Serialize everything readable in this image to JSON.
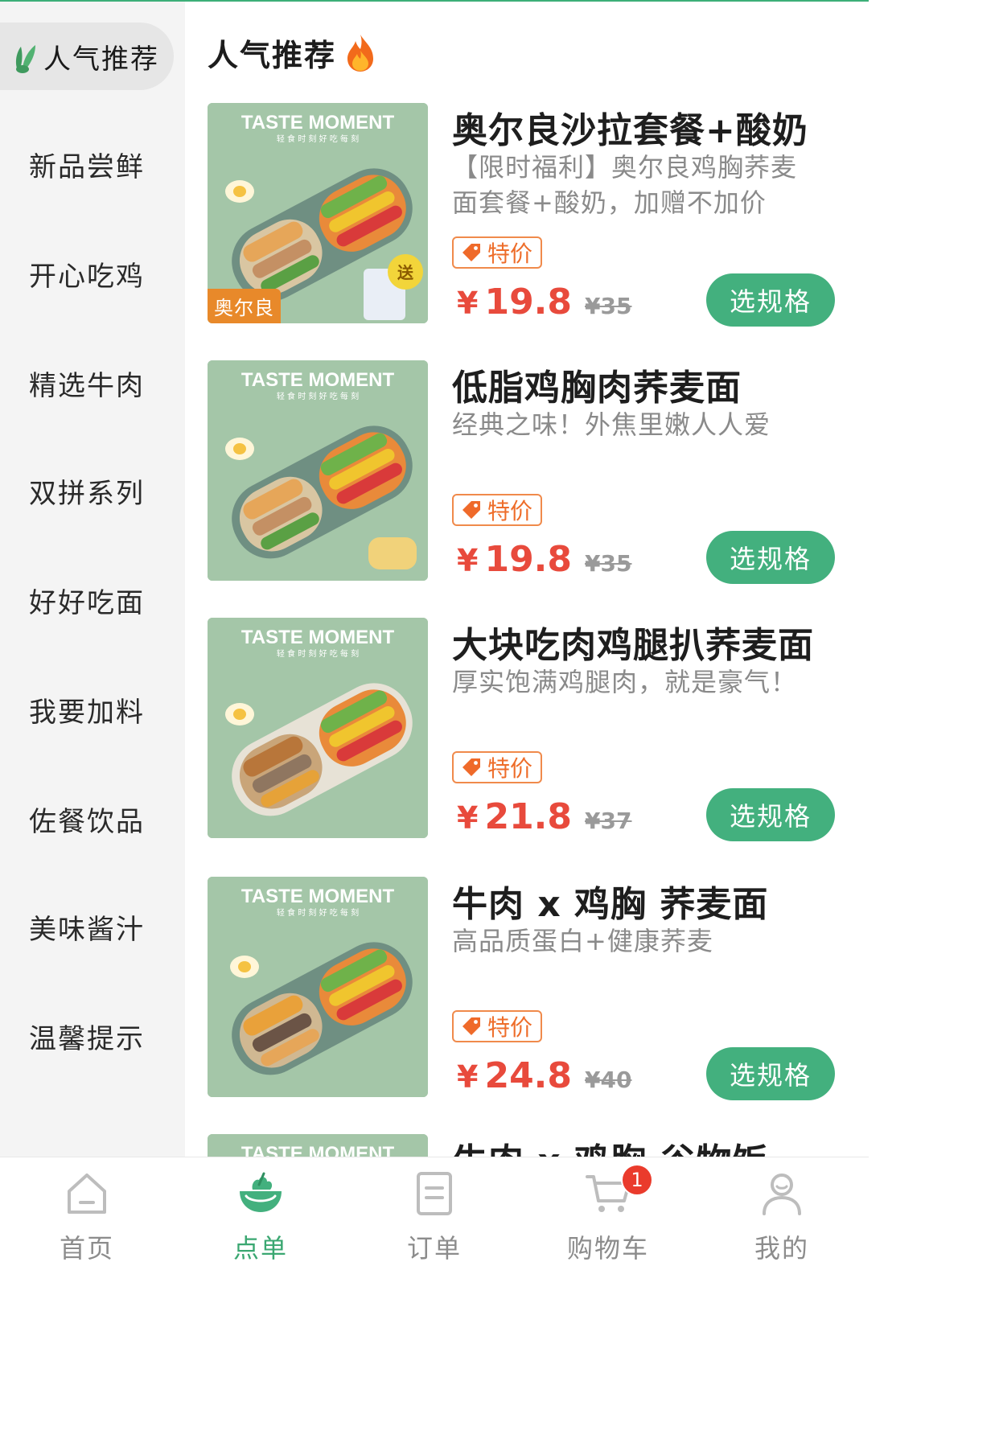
{
  "sidebar": {
    "items": [
      {
        "label": "人气推荐"
      },
      {
        "label": "新品尝鲜"
      },
      {
        "label": "开心吃鸡"
      },
      {
        "label": "精选牛肉"
      },
      {
        "label": "双拼系列"
      },
      {
        "label": "好好吃面"
      },
      {
        "label": "我要加料"
      },
      {
        "label": "佐餐饮品"
      },
      {
        "label": "美味酱汁"
      },
      {
        "label": "温馨提示"
      }
    ]
  },
  "section": {
    "title": "人气推荐"
  },
  "image_text": {
    "line1": "TASTE MOMENT",
    "line2": "轻 食 时 刻     好 吃 每 刻",
    "gift": "送"
  },
  "products": [
    {
      "name": "奥尔良沙拉套餐+酸奶",
      "desc": "【限时福利】奥尔良鸡胸荞麦面套餐+酸奶，加赠不加价",
      "brand_tag": "奥尔良",
      "tag": "特价",
      "currency": "¥",
      "price": "19.8",
      "old_price": "¥35",
      "button": "选规格"
    },
    {
      "name": "低脂鸡胸肉荞麦面",
      "desc": "经典之味！外焦里嫩人人爱",
      "tag": "特价",
      "currency": "¥",
      "price": "19.8",
      "old_price": "¥35",
      "button": "选规格"
    },
    {
      "name": "大块吃肉鸡腿扒荞麦面",
      "desc": "厚实饱满鸡腿肉，就是豪气！",
      "tag": "特价",
      "currency": "¥",
      "price": "21.8",
      "old_price": "¥37",
      "button": "选规格"
    },
    {
      "name": "牛肉 x 鸡胸 荞麦面",
      "desc": "高品质蛋白+健康荞麦",
      "tag": "特价",
      "currency": "¥",
      "price": "24.8",
      "old_price": "¥40",
      "button": "选规格"
    },
    {
      "name": "牛肉 x 鸡胸 谷物饭"
    }
  ],
  "tabbar": {
    "items": [
      {
        "label": "首页",
        "icon": "home-icon"
      },
      {
        "label": "点单",
        "icon": "salad-bowl-icon"
      },
      {
        "label": "订单",
        "icon": "order-list-icon"
      },
      {
        "label": "购物车",
        "icon": "cart-icon",
        "badge": "1"
      },
      {
        "label": "我的",
        "icon": "user-icon"
      }
    ],
    "active": "点单"
  },
  "colors": {
    "accent": "#43b07e",
    "price": "#e84a3c",
    "tag": "#ee6d2a",
    "badge": "#ea3b2c"
  }
}
